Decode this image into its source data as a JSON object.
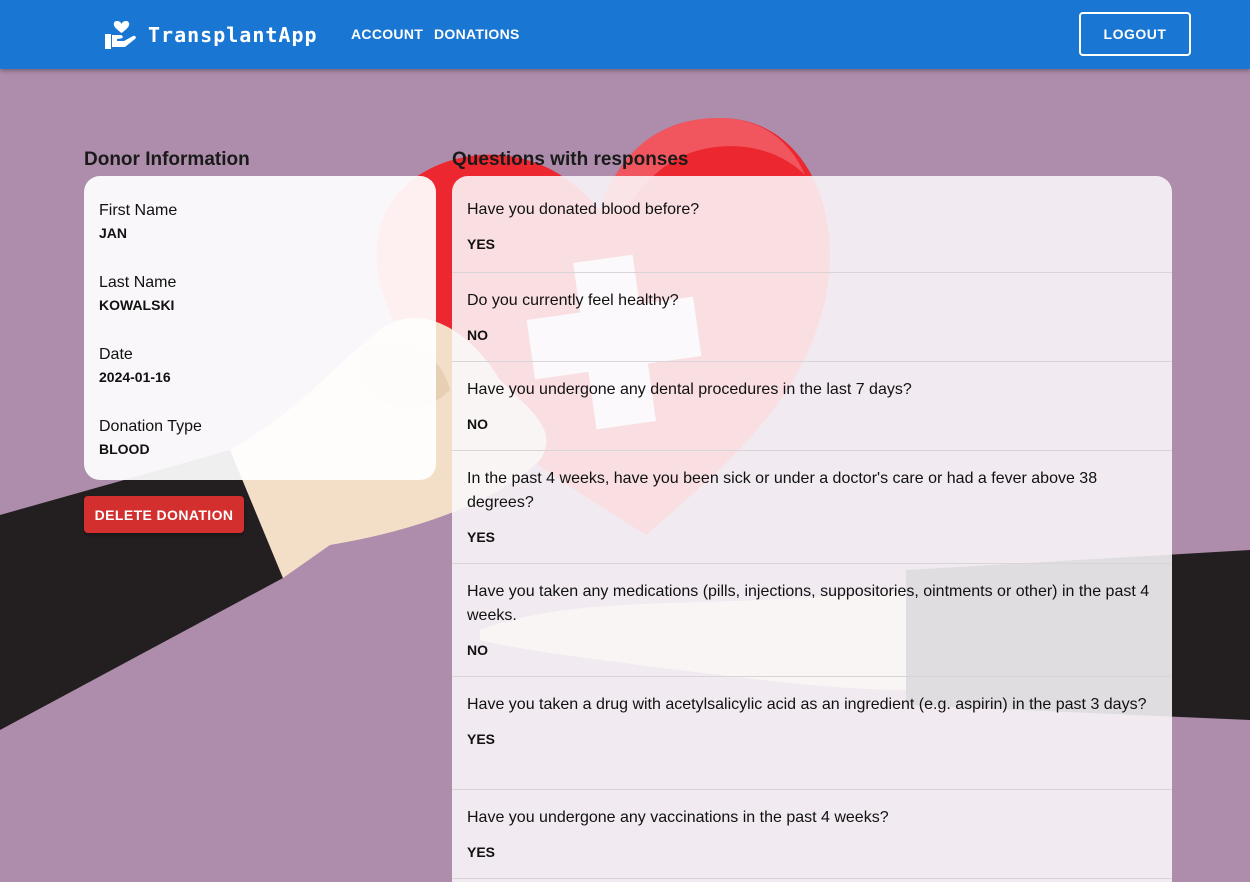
{
  "app": {
    "name": "TransplantApp"
  },
  "nav": {
    "account": "ACCOUNT",
    "donations": "DONATIONS",
    "logout": "LOGOUT"
  },
  "donor": {
    "title": "Donor Information",
    "fields": [
      {
        "label": "First Name",
        "value": "JAN"
      },
      {
        "label": "Last Name",
        "value": "KOWALSKI"
      },
      {
        "label": "Date",
        "value": "2024-01-16"
      },
      {
        "label": "Donation Type",
        "value": "BLOOD"
      }
    ],
    "delete_label": "DELETE DONATION"
  },
  "questions": {
    "title": "Questions with responses",
    "items": [
      {
        "question": "Have you donated blood before?",
        "answer": "YES"
      },
      {
        "question": "Do you currently feel healthy?",
        "answer": "NO"
      },
      {
        "question": "Have you undergone any dental procedures in the last 7 days?",
        "answer": "NO"
      },
      {
        "question": "In the past 4 weeks, have you been sick or under a doctor's care or had a fever above 38 degrees?",
        "answer": "YES"
      },
      {
        "question": "Have you taken any medications (pills, injections, suppositories, ointments or other) in the past 4 weeks.",
        "answer": "NO"
      },
      {
        "question": "Have you taken a drug with acetylsalicylic acid as an ingredient (e.g. aspirin) in the past 3 days?",
        "answer": "YES"
      },
      {
        "question": "Have you undergone any vaccinations in the past 4 weeks?",
        "answer": "YES"
      }
    ]
  },
  "colors": {
    "appbar": "#1976d2",
    "background": "#ad8dab",
    "delete": "#d32f2f",
    "heart": "#ec2730"
  }
}
